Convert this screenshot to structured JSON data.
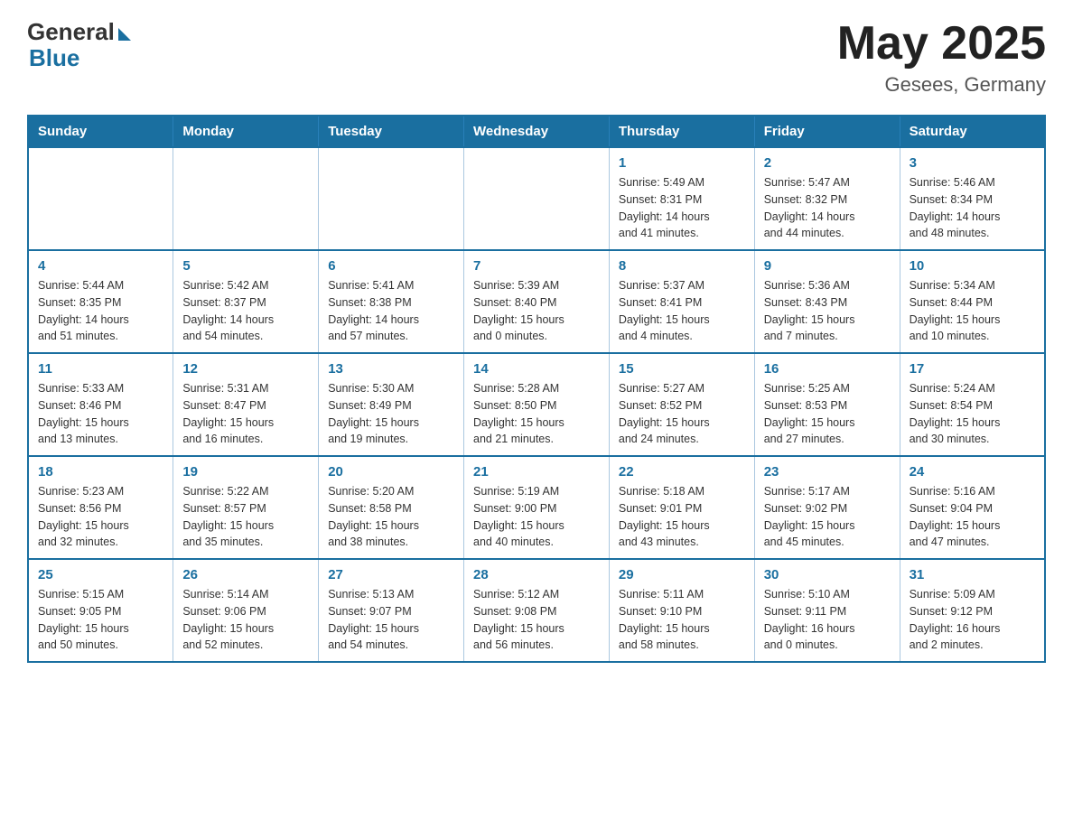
{
  "header": {
    "logo_general": "General",
    "logo_blue": "Blue",
    "month_title": "May 2025",
    "location": "Gesees, Germany"
  },
  "weekdays": [
    "Sunday",
    "Monday",
    "Tuesday",
    "Wednesday",
    "Thursday",
    "Friday",
    "Saturday"
  ],
  "weeks": [
    [
      {
        "day": "",
        "info": ""
      },
      {
        "day": "",
        "info": ""
      },
      {
        "day": "",
        "info": ""
      },
      {
        "day": "",
        "info": ""
      },
      {
        "day": "1",
        "info": "Sunrise: 5:49 AM\nSunset: 8:31 PM\nDaylight: 14 hours\nand 41 minutes."
      },
      {
        "day": "2",
        "info": "Sunrise: 5:47 AM\nSunset: 8:32 PM\nDaylight: 14 hours\nand 44 minutes."
      },
      {
        "day": "3",
        "info": "Sunrise: 5:46 AM\nSunset: 8:34 PM\nDaylight: 14 hours\nand 48 minutes."
      }
    ],
    [
      {
        "day": "4",
        "info": "Sunrise: 5:44 AM\nSunset: 8:35 PM\nDaylight: 14 hours\nand 51 minutes."
      },
      {
        "day": "5",
        "info": "Sunrise: 5:42 AM\nSunset: 8:37 PM\nDaylight: 14 hours\nand 54 minutes."
      },
      {
        "day": "6",
        "info": "Sunrise: 5:41 AM\nSunset: 8:38 PM\nDaylight: 14 hours\nand 57 minutes."
      },
      {
        "day": "7",
        "info": "Sunrise: 5:39 AM\nSunset: 8:40 PM\nDaylight: 15 hours\nand 0 minutes."
      },
      {
        "day": "8",
        "info": "Sunrise: 5:37 AM\nSunset: 8:41 PM\nDaylight: 15 hours\nand 4 minutes."
      },
      {
        "day": "9",
        "info": "Sunrise: 5:36 AM\nSunset: 8:43 PM\nDaylight: 15 hours\nand 7 minutes."
      },
      {
        "day": "10",
        "info": "Sunrise: 5:34 AM\nSunset: 8:44 PM\nDaylight: 15 hours\nand 10 minutes."
      }
    ],
    [
      {
        "day": "11",
        "info": "Sunrise: 5:33 AM\nSunset: 8:46 PM\nDaylight: 15 hours\nand 13 minutes."
      },
      {
        "day": "12",
        "info": "Sunrise: 5:31 AM\nSunset: 8:47 PM\nDaylight: 15 hours\nand 16 minutes."
      },
      {
        "day": "13",
        "info": "Sunrise: 5:30 AM\nSunset: 8:49 PM\nDaylight: 15 hours\nand 19 minutes."
      },
      {
        "day": "14",
        "info": "Sunrise: 5:28 AM\nSunset: 8:50 PM\nDaylight: 15 hours\nand 21 minutes."
      },
      {
        "day": "15",
        "info": "Sunrise: 5:27 AM\nSunset: 8:52 PM\nDaylight: 15 hours\nand 24 minutes."
      },
      {
        "day": "16",
        "info": "Sunrise: 5:25 AM\nSunset: 8:53 PM\nDaylight: 15 hours\nand 27 minutes."
      },
      {
        "day": "17",
        "info": "Sunrise: 5:24 AM\nSunset: 8:54 PM\nDaylight: 15 hours\nand 30 minutes."
      }
    ],
    [
      {
        "day": "18",
        "info": "Sunrise: 5:23 AM\nSunset: 8:56 PM\nDaylight: 15 hours\nand 32 minutes."
      },
      {
        "day": "19",
        "info": "Sunrise: 5:22 AM\nSunset: 8:57 PM\nDaylight: 15 hours\nand 35 minutes."
      },
      {
        "day": "20",
        "info": "Sunrise: 5:20 AM\nSunset: 8:58 PM\nDaylight: 15 hours\nand 38 minutes."
      },
      {
        "day": "21",
        "info": "Sunrise: 5:19 AM\nSunset: 9:00 PM\nDaylight: 15 hours\nand 40 minutes."
      },
      {
        "day": "22",
        "info": "Sunrise: 5:18 AM\nSunset: 9:01 PM\nDaylight: 15 hours\nand 43 minutes."
      },
      {
        "day": "23",
        "info": "Sunrise: 5:17 AM\nSunset: 9:02 PM\nDaylight: 15 hours\nand 45 minutes."
      },
      {
        "day": "24",
        "info": "Sunrise: 5:16 AM\nSunset: 9:04 PM\nDaylight: 15 hours\nand 47 minutes."
      }
    ],
    [
      {
        "day": "25",
        "info": "Sunrise: 5:15 AM\nSunset: 9:05 PM\nDaylight: 15 hours\nand 50 minutes."
      },
      {
        "day": "26",
        "info": "Sunrise: 5:14 AM\nSunset: 9:06 PM\nDaylight: 15 hours\nand 52 minutes."
      },
      {
        "day": "27",
        "info": "Sunrise: 5:13 AM\nSunset: 9:07 PM\nDaylight: 15 hours\nand 54 minutes."
      },
      {
        "day": "28",
        "info": "Sunrise: 5:12 AM\nSunset: 9:08 PM\nDaylight: 15 hours\nand 56 minutes."
      },
      {
        "day": "29",
        "info": "Sunrise: 5:11 AM\nSunset: 9:10 PM\nDaylight: 15 hours\nand 58 minutes."
      },
      {
        "day": "30",
        "info": "Sunrise: 5:10 AM\nSunset: 9:11 PM\nDaylight: 16 hours\nand 0 minutes."
      },
      {
        "day": "31",
        "info": "Sunrise: 5:09 AM\nSunset: 9:12 PM\nDaylight: 16 hours\nand 2 minutes."
      }
    ]
  ]
}
